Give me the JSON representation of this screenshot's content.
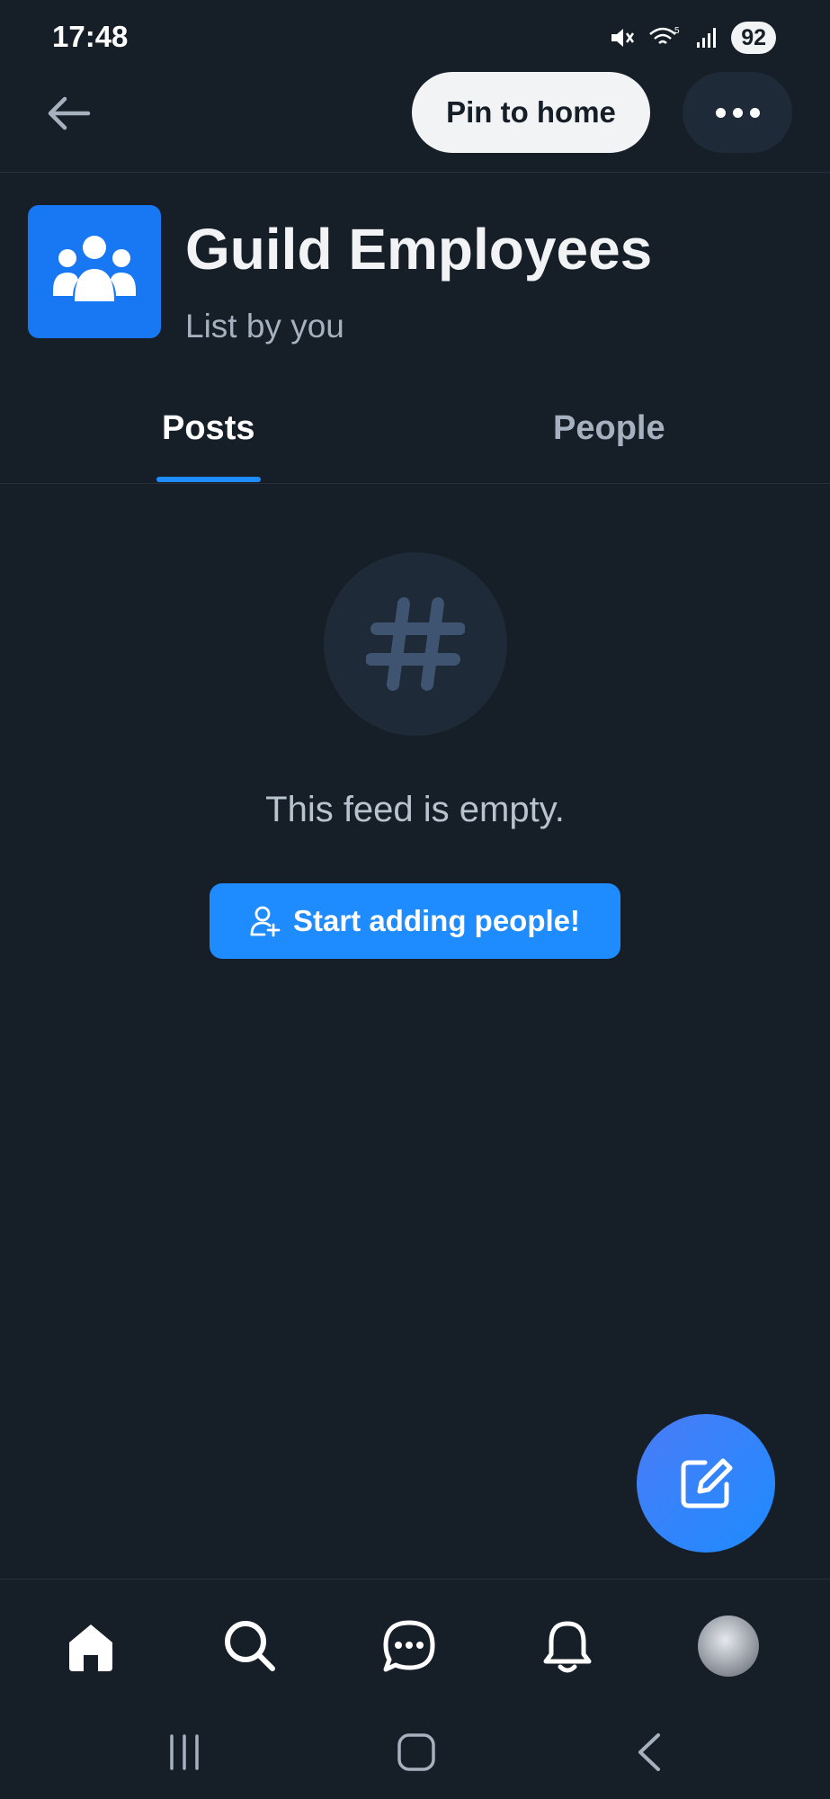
{
  "status_bar": {
    "time": "17:48",
    "battery": "92"
  },
  "header": {
    "pin_label": "Pin to home"
  },
  "list": {
    "title": "Guild Employees",
    "subtitle": "List by you"
  },
  "tabs": [
    {
      "label": "Posts",
      "active": true
    },
    {
      "label": "People",
      "active": false
    }
  ],
  "empty_state": {
    "message": "This feed is empty.",
    "button_label": "Start adding people!"
  },
  "colors": {
    "background": "#161e27",
    "accent": "#1e8bff",
    "list_avatar": "#1877f2",
    "muted_text": "#a5b1bf"
  },
  "icons": {
    "back": "arrow-left-icon",
    "more": "ellipsis-icon",
    "list": "people-group-icon",
    "empty": "hashtag-icon",
    "add_person": "user-plus-icon",
    "compose": "edit-icon",
    "nav": [
      "home-icon",
      "search-icon",
      "chat-icon",
      "bell-icon",
      "avatar"
    ]
  }
}
